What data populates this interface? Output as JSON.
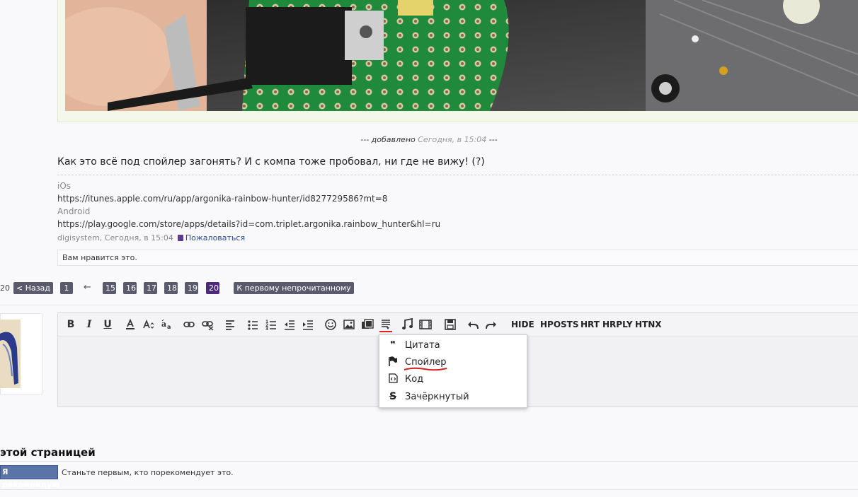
{
  "post": {
    "merged_prefix": "--- добавлено",
    "merged_time": "Сегодня, в 15:04",
    "merged_suffix": "---",
    "text": "Как это всё под спойлер загонять? И с компа тоже пробовал, ни где не вижу! (?)",
    "signature": {
      "ios_label": "iOs",
      "ios_url": "https://itunes.apple.com/ru/app/argonika-rainbow-hunter/id827729586?mt=8",
      "android_label": "Android",
      "android_url": "https://play.google.com/store/apps/details?id=com.triplet.argonika.rainbow_hunter&hl=ru"
    },
    "author_time": "digisystem, Сегодня, в 15:04",
    "report_label": "Пожаловаться",
    "likes_text": "Вам нравится это."
  },
  "pagination": {
    "fragment": "20",
    "back_label": "< Назад",
    "first_page": "1",
    "ellipsis_arrow": "←",
    "pages": [
      "15",
      "16",
      "17",
      "18",
      "19",
      "20"
    ],
    "current": "20",
    "unread_label": "К первому непрочитанному"
  },
  "toolbar": {
    "bold": "B",
    "italic": "I",
    "underline": "U",
    "text_buttons": [
      "HIDE",
      "HPOSTS",
      "HRT",
      "HRPLY",
      "HTNX"
    ]
  },
  "dropdown": {
    "items": [
      {
        "icon": "quote-icon",
        "label": "Цитата"
      },
      {
        "icon": "flag-icon",
        "label": "Спойлер"
      },
      {
        "icon": "code-icon",
        "label": "Код"
      },
      {
        "icon": "strikethrough-icon",
        "label": "Зачёркнутый"
      }
    ]
  },
  "share": {
    "title": "этой страницей",
    "recommend_button": "Я рекомендую",
    "recommend_note": "Станьте первым, кто порекомендует это."
  },
  "colors": {
    "pager_bg": "#5a5a6c",
    "pager_current": "#4b2a7a",
    "fb_button": "#5b74a8",
    "underline_red": "#d22222"
  }
}
